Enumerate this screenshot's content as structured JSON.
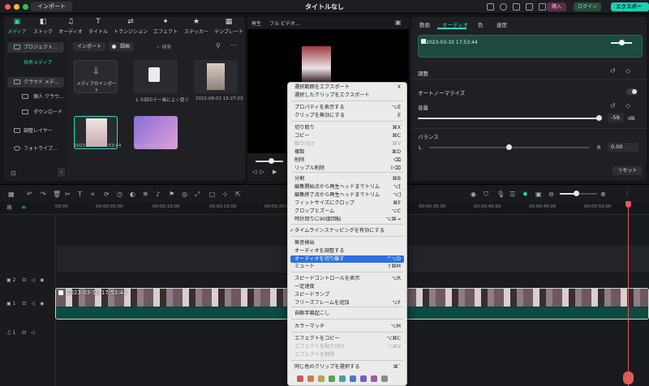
{
  "titlebar": {
    "import_label": "インポート",
    "title": "タイトルなし",
    "buy_label": "購入",
    "login_label": "ログイン",
    "export_label": "エクスポート"
  },
  "media_tabs": [
    {
      "label": "メディア",
      "icon": "media-icon",
      "glyph": "▣"
    },
    {
      "label": "ストック",
      "icon": "stock-icon",
      "glyph": "◧"
    },
    {
      "label": "オーディオ",
      "icon": "music-icon",
      "glyph": "♫"
    },
    {
      "label": "タイトル",
      "icon": "title-icon",
      "glyph": "T"
    },
    {
      "label": "トランジション",
      "icon": "transition-icon",
      "glyph": "⇄"
    },
    {
      "label": "エフェクト",
      "icon": "effect-icon",
      "glyph": "✦"
    },
    {
      "label": "ステッカー",
      "icon": "sticker-icon",
      "glyph": "★"
    },
    {
      "label": "テンプレート",
      "icon": "template-icon",
      "glyph": "▦"
    }
  ],
  "sidebar": {
    "items": [
      {
        "label": "プロジェクト..."
      },
      {
        "label": "共有メディア"
      },
      {
        "label": "クラウド メデ..."
      },
      {
        "label": "個人 クラウ..."
      },
      {
        "label": "ダウンロード"
      },
      {
        "label": "調整レイヤー"
      },
      {
        "label": "フォトライブ..."
      }
    ]
  },
  "media_toolbar": {
    "import_dropdown": "インポート",
    "sort_dropdown": "録画",
    "search_placeholder": "検索"
  },
  "media_items": [
    {
      "label": "メディアのインポート"
    },
    {
      "label": "1.今回のテー画によく使う"
    },
    {
      "label": "2022-08-02 15:27:23"
    },
    {
      "label": "2023-03-10 17:53:44"
    },
    {
      "label": "vc-video-1"
    }
  ],
  "preview": {
    "player_label": "再生",
    "quality_label": "フル ビデオ..."
  },
  "right_tabs": [
    {
      "label": "動画"
    },
    {
      "label": "オーディオ"
    },
    {
      "label": "色"
    },
    {
      "label": "速度"
    }
  ],
  "audio_panel": {
    "clip_timestamp": "2023-03-10 17:53:44",
    "adjust_label": "調整",
    "auto_normalize_label": "オートノーマライズ",
    "volume_label": "音量",
    "volume_value": "-59.",
    "volume_unit": "dB",
    "balance_label": "バランス",
    "balance_left": "L",
    "balance_right": "R",
    "balance_value": "0.00",
    "reset_label": "リセット"
  },
  "ruler": {
    "ticks": [
      "00:00",
      "00:00:05:00",
      "00:00:10:00",
      "00:00:15:00",
      "00:00:20:00",
      "00:00:35:00",
      "00:00:40:00",
      "00:00:45:00",
      "00:00:50:00"
    ]
  },
  "tracks": {
    "track2": "2",
    "track1": "1",
    "audio1": "1",
    "clip_title": "2023-03-10 17:53:44"
  },
  "context_menu": {
    "items": [
      {
        "label": "選択範囲をエクスポート",
        "shortcut": "X"
      },
      {
        "label": "選択したクリップをエクスポート",
        "shortcut": ""
      },
      {
        "label": "プロパティを表示する",
        "shortcut": "⌥E"
      },
      {
        "label": "クリップを無効にする",
        "shortcut": "E"
      },
      {
        "label": "切り取り",
        "shortcut": "⌘X"
      },
      {
        "label": "コピー",
        "shortcut": "⌘C"
      },
      {
        "label": "貼り付け",
        "shortcut": "⌘V"
      },
      {
        "label": "複製",
        "shortcut": "⌘D"
      },
      {
        "label": "削除",
        "shortcut": "⌫"
      },
      {
        "label": "リップル削除",
        "shortcut": "⇧⌫"
      },
      {
        "label": "分割",
        "shortcut": "⌘B"
      },
      {
        "label": "編集開始点から再生ヘッドまでトリム",
        "shortcut": "⌥["
      },
      {
        "label": "編集終了点から再生ヘッドまでトリム",
        "shortcut": "⌥]"
      },
      {
        "label": "フィットサイズにクロップ",
        "shortcut": "⌘F"
      },
      {
        "label": "クロップとズーム",
        "shortcut": "⌥C"
      },
      {
        "label": "時計回りに90度回転",
        "shortcut": "⌥⌘→"
      },
      {
        "label": "タイムラインスナッピングを有効にする",
        "shortcut": ""
      },
      {
        "label": "無音検出",
        "shortcut": ""
      },
      {
        "label": "オーディオを調整する",
        "shortcut": ""
      },
      {
        "label": "オーディオを切り離す",
        "shortcut": "^⌥D"
      },
      {
        "label": "ミュート",
        "shortcut": "⇧⌘M"
      },
      {
        "label": "スピードコントロールを表示",
        "shortcut": "⌥R"
      },
      {
        "label": "一定速度",
        "shortcut": ""
      },
      {
        "label": "スピードランプ",
        "shortcut": ""
      },
      {
        "label": "フリーズフレームを追加",
        "shortcut": "⌥F"
      },
      {
        "label": "自動字幕起こし",
        "shortcut": ""
      },
      {
        "label": "カラーマッチ",
        "shortcut": "⌥M"
      },
      {
        "label": "エフェクトをコピー",
        "shortcut": "⌥⌘C"
      },
      {
        "label": "エフェクトを貼り付け",
        "shortcut": "⌥⌘V"
      },
      {
        "label": "エフェクトを削除",
        "shortcut": ""
      },
      {
        "label": "同じ色のクリップを選択する",
        "shortcut": "⌘`"
      }
    ],
    "swatch_colors": [
      "#c85a5a",
      "#c87f4a",
      "#b8a24a",
      "#5aa05a",
      "#4aa0a0",
      "#4a78c8",
      "#7a5ac8",
      "#a05aa0",
      "#8a8a8a"
    ]
  }
}
